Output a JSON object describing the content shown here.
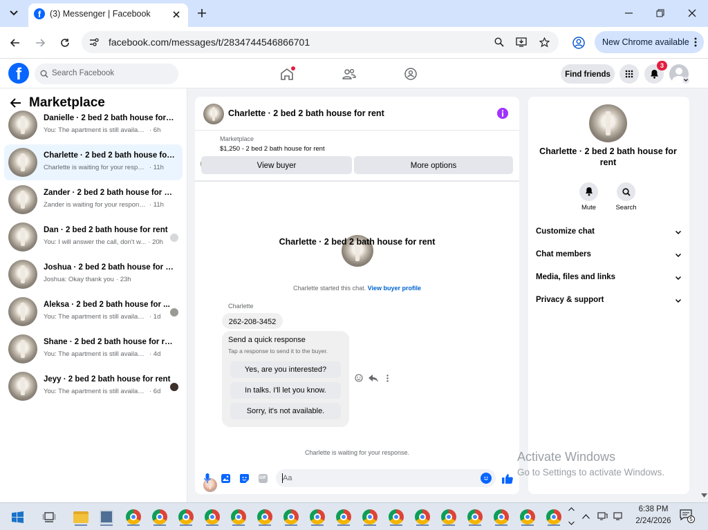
{
  "browser": {
    "tab_title": "(3) Messenger | Facebook",
    "url": "facebook.com/messages/t/2834744546866701",
    "update_label": "New Chrome available"
  },
  "fb": {
    "search_placeholder": "Search Facebook",
    "find_friends": "Find friends",
    "notif_count": "3"
  },
  "left": {
    "title": "Marketplace",
    "convos": [
      {
        "title": "Danielle · 2 bed 2 bath house for r...",
        "preview": "You: The apartment is still available fo...",
        "time": "· 6h"
      },
      {
        "title": "Charlette · 2 bed 2 bath house for ...",
        "preview": "Charlette is waiting for your response.",
        "time": "· 11h"
      },
      {
        "title": "Zander · 2 bed 2 bath house for rent",
        "preview": "Zander is waiting for your response.",
        "time": "· 11h"
      },
      {
        "title": "Dan · 2 bed 2 bath house for rent",
        "preview": "You: I will answer the call, don't w...",
        "time": "· 20h"
      },
      {
        "title": "Joshua · 2 bed 2 bath house for rent",
        "preview": "Joshua: Okay thank you",
        "time": "· 23h"
      },
      {
        "title": "Aleksa · 2 bed 2 bath house for ...",
        "preview": "You: The apartment is still available...",
        "time": "· 1d"
      },
      {
        "title": "Shane · 2 bed 2 bath house for rent",
        "preview": "You: The apartment is still available fo...",
        "time": "· 4d"
      },
      {
        "title": "Jeyy · 2 bed 2 bath house for rent",
        "preview": "You: The apartment is still available...",
        "time": "· 6d"
      }
    ]
  },
  "chat": {
    "header_title": "Charlette · 2 bed 2 bath house for rent",
    "listing_source": "Marketplace",
    "listing_text": "$1,250 - 2 bed 2 bath house for rent",
    "view_buyer": "View buyer",
    "more_options": "More options",
    "intro_name": "Charlette · 2 bed 2 bath house for rent",
    "started_text": "Charlette started this chat.",
    "view_profile": "View buyer profile",
    "sender": "Charlette",
    "message": "262-208-3452",
    "quick_title": "Send a quick response",
    "quick_sub": "Tap a response to send it to the buyer.",
    "quick_replies": [
      "Yes, are you interested?",
      "In talks. I'll let you know.",
      "Sorry, it's not available."
    ],
    "waiting": "Charlette is waiting for your response.",
    "composer_placeholder": "Aa"
  },
  "info": {
    "name": "Charlette · 2 bed 2 bath house for rent",
    "mute": "Mute",
    "search": "Search",
    "sections": [
      "Customize chat",
      "Chat members",
      "Media, files and links",
      "Privacy & support"
    ]
  },
  "watermark": {
    "line1": "Activate Windows",
    "line2": "Go to Settings to activate Windows."
  },
  "taskbar": {
    "time": "6:38 PM",
    "date": "2/24/2026",
    "notif_count": "5"
  },
  "colors": {
    "fb_blue": "#0866ff",
    "link_blue": "#0064d1",
    "accent_purple": "#a033ff",
    "badge_red": "#e41e3f",
    "selected_row": "#ebf5ff"
  }
}
